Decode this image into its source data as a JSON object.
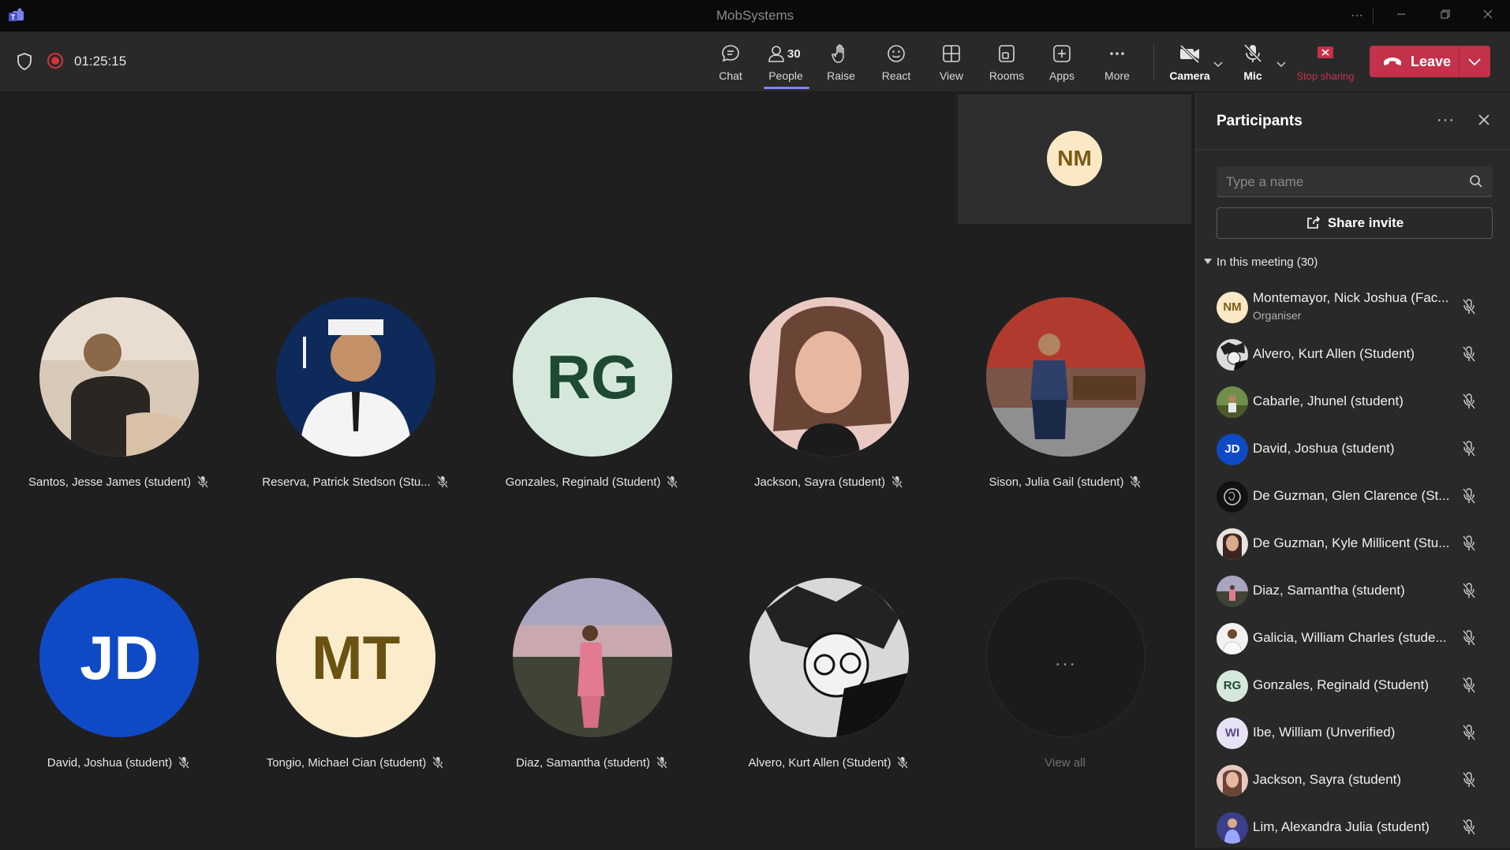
{
  "window": {
    "title": "MobSystems"
  },
  "toolbar": {
    "timer": "01:25:15",
    "buttons": [
      {
        "label": "Chat"
      },
      {
        "label": "People",
        "count": "30"
      },
      {
        "label": "Raise"
      },
      {
        "label": "React"
      },
      {
        "label": "View"
      },
      {
        "label": "Rooms"
      },
      {
        "label": "Apps"
      },
      {
        "label": "More"
      }
    ],
    "camera_label": "Camera",
    "mic_label": "Mic",
    "stop_sharing_label": "Stop sharing",
    "leave_label": "Leave",
    "colors": {
      "leave": "#c4314b",
      "people_underline": "#7f85f5",
      "recording": "#d13438"
    }
  },
  "self_view": {
    "initials": "NM"
  },
  "stage": {
    "tiles": [
      {
        "name": "Santos, Jesse James (student)",
        "initials": ""
      },
      {
        "name": "Reserva, Patrick Stedson (Stu...",
        "initials": ""
      },
      {
        "name": "Gonzales, Reginald (Student)",
        "initials": "RG"
      },
      {
        "name": "Jackson, Sayra (student)",
        "initials": ""
      },
      {
        "name": "Sison, Julia Gail (student)",
        "initials": ""
      },
      {
        "name": "David, Joshua (student)",
        "initials": "JD"
      },
      {
        "name": "Tongio, Michael Cian (student)",
        "initials": "MT"
      },
      {
        "name": "Diaz, Samantha (student)",
        "initials": ""
      },
      {
        "name": "Alvero, Kurt Allen (Student)",
        "initials": ""
      }
    ],
    "view_all_label": "View all",
    "view_all_dots": "..."
  },
  "panel": {
    "title": "Participants",
    "search_placeholder": "Type a name",
    "share_invite_label": "Share invite",
    "section_label": "In this meeting (30)",
    "participants": [
      {
        "name": "Montemayor, Nick Joshua (Fac...",
        "role": "Organiser",
        "initials": "NM"
      },
      {
        "name": "Alvero, Kurt Allen (Student)",
        "initials": ""
      },
      {
        "name": "Cabarle, Jhunel (student)",
        "initials": ""
      },
      {
        "name": "David, Joshua (student)",
        "initials": "JD"
      },
      {
        "name": "De Guzman, Glen Clarence (St...",
        "initials": ""
      },
      {
        "name": "De Guzman, Kyle Millicent (Stu...",
        "initials": ""
      },
      {
        "name": "Diaz, Samantha (student)",
        "initials": ""
      },
      {
        "name": "Galicia, William Charles (stude...",
        "initials": ""
      },
      {
        "name": "Gonzales, Reginald (Student)",
        "initials": "RG"
      },
      {
        "name": "Ibe, William (Unverified)",
        "initials": "WI"
      },
      {
        "name": "Jackson, Sayra (student)",
        "initials": ""
      },
      {
        "name": "Lim, Alexandra Julia (student)",
        "initials": ""
      }
    ]
  }
}
